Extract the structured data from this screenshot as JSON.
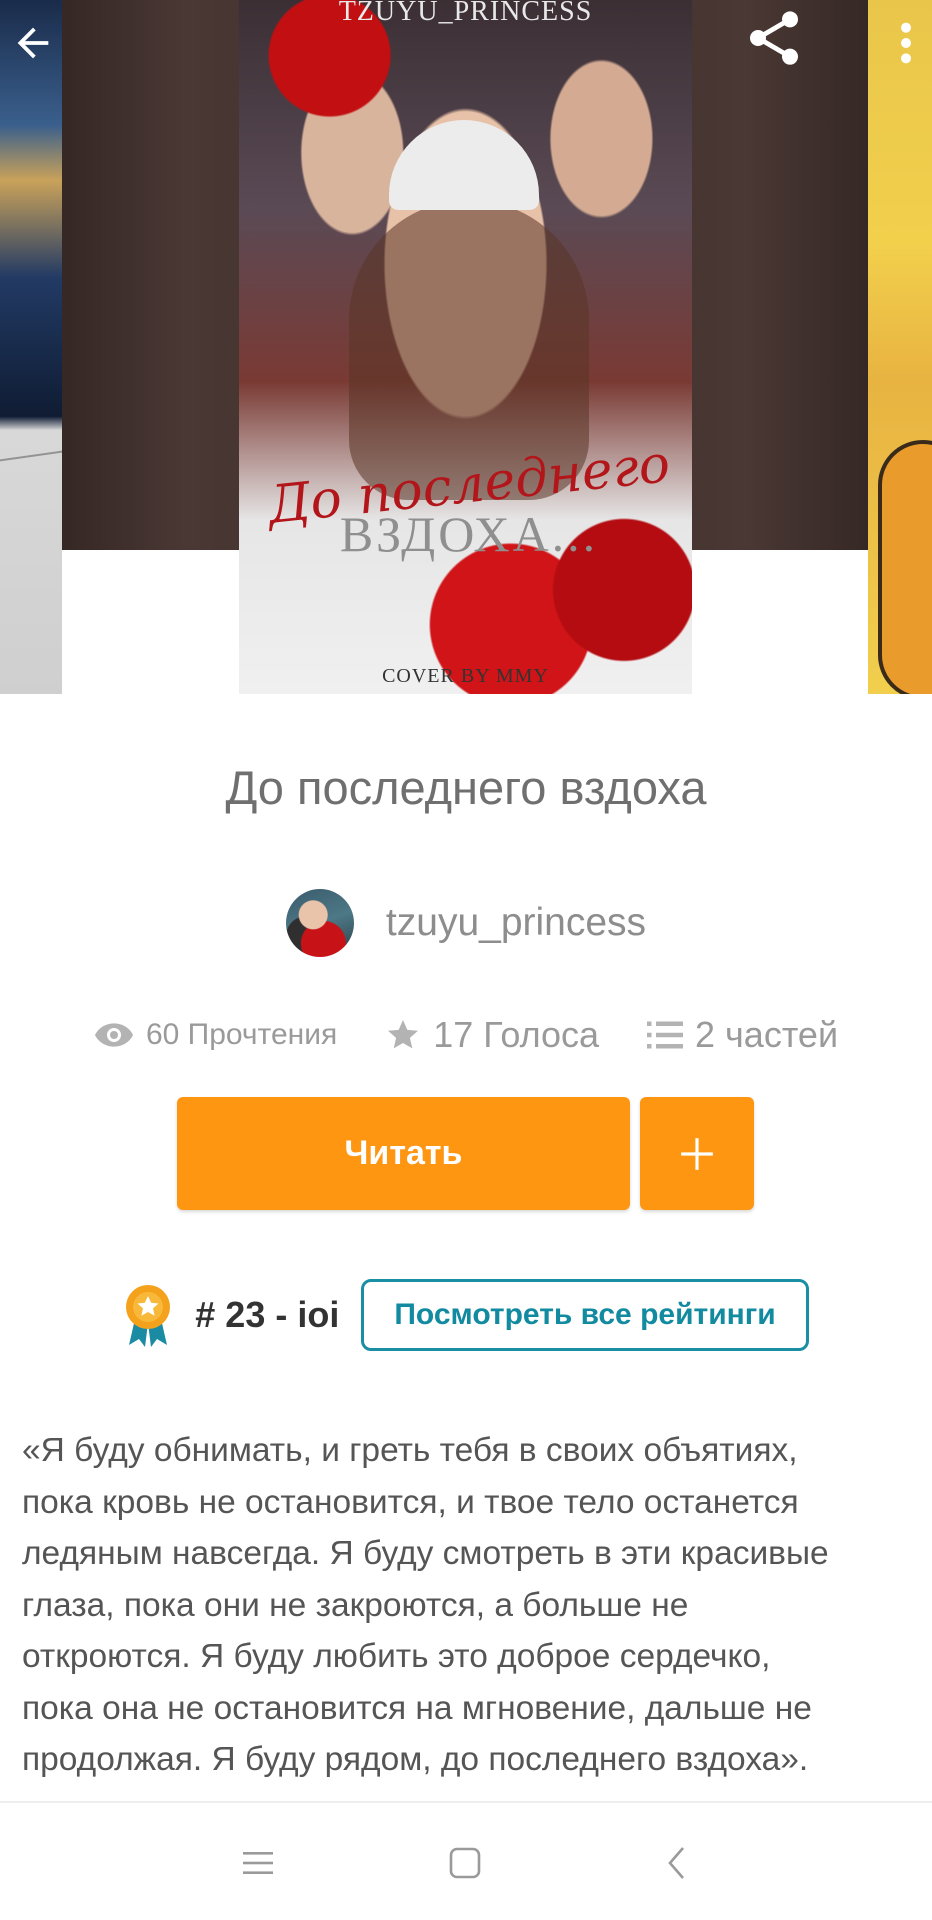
{
  "cover": {
    "top_text": "TZUYU_PRINCESS",
    "script_text": "До последнего",
    "title_text": "ВЗДОХА...",
    "credit_text": "COVER BY MMY"
  },
  "toolbar": {
    "back_icon": "arrow-left-icon",
    "share_icon": "share-icon",
    "more_icon": "more-vertical-icon"
  },
  "story": {
    "title": "До последнего вздоха",
    "author": "tzuyu_princess"
  },
  "stats": {
    "views": "60 Прочтения",
    "votes": "17 Голоса",
    "parts": "2 частей"
  },
  "actions": {
    "read_label": "Читать",
    "add_icon": "plus-icon"
  },
  "ranking": {
    "rank_text": "# 23 - ioi",
    "link_label": "Посмотреть все рейтинги"
  },
  "description": "«Я буду обнимать, и греть тебя в своих объятиях,\nпока кровь не остановится, и твое тело останется\nледяным навсегда. Я буду смотреть в эти красивые\nглаза, пока они не закроются, а больше не\nоткроются. Я буду любить это доброе сердечко,\nпока она не остановится на мгновение, дальше не\nпродолжая. Я буду рядом, до последнего вздоха».",
  "colors": {
    "accent_orange": "#ff9612",
    "link_teal": "#128aa0",
    "title_gray": "#6f6f6f"
  }
}
